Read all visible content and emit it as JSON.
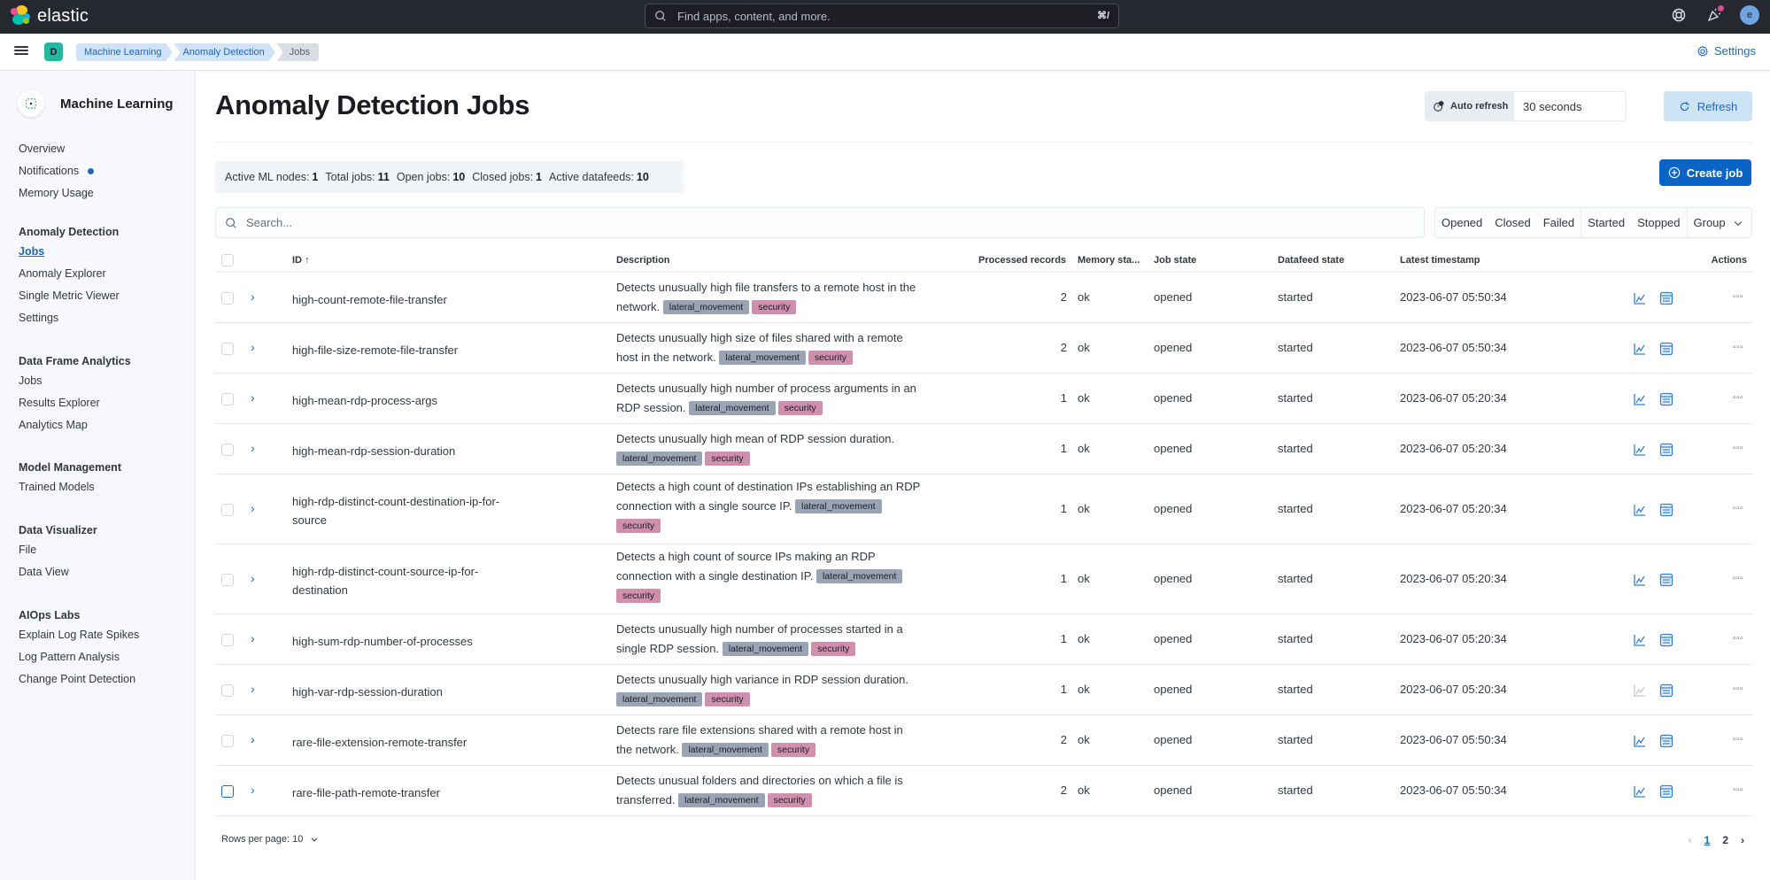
{
  "header": {
    "brand": "elastic",
    "search_placeholder": "Find apps, content, and more.",
    "search_shortcut": "⌘/",
    "avatar_initial": "e"
  },
  "subheader": {
    "space_initial": "D",
    "breadcrumbs": [
      "Machine Learning",
      "Anomaly Detection",
      "Jobs"
    ],
    "settings_label": "Settings"
  },
  "sidebar": {
    "title": "Machine Learning",
    "top_items": [
      {
        "label": "Overview"
      },
      {
        "label": "Notifications",
        "has_dot": true
      },
      {
        "label": "Memory Usage"
      }
    ],
    "groups": [
      {
        "heading": "Anomaly Detection",
        "items": [
          "Jobs",
          "Anomaly Explorer",
          "Single Metric Viewer",
          "Settings"
        ],
        "active": "Jobs"
      },
      {
        "heading": "Data Frame Analytics",
        "items": [
          "Jobs",
          "Results Explorer",
          "Analytics Map"
        ]
      },
      {
        "heading": "Model Management",
        "items": [
          "Trained Models"
        ]
      },
      {
        "heading": "Data Visualizer",
        "items": [
          "File",
          "Data View"
        ]
      },
      {
        "heading": "AIOps Labs",
        "items": [
          "Explain Log Rate Spikes",
          "Log Pattern Analysis",
          "Change Point Detection"
        ]
      }
    ]
  },
  "page": {
    "title": "Anomaly Detection Jobs",
    "auto_refresh_label": "Auto refresh",
    "auto_refresh_value": "30 seconds",
    "refresh_label": "Refresh",
    "create_job_label": "Create job",
    "stats": [
      {
        "label": "Active ML nodes:",
        "value": "1"
      },
      {
        "label": "Total jobs:",
        "value": "11"
      },
      {
        "label": "Open jobs:",
        "value": "10"
      },
      {
        "label": "Closed jobs:",
        "value": "1"
      },
      {
        "label": "Active datafeeds:",
        "value": "10"
      }
    ],
    "search_placeholder": "Search...",
    "filters": {
      "job_state": [
        "Opened",
        "Closed",
        "Failed"
      ],
      "datafeed_state": [
        "Started",
        "Stopped"
      ],
      "group": "Group"
    }
  },
  "table": {
    "columns": [
      "ID",
      "Description",
      "Processed records",
      "Memory sta...",
      "Job state",
      "Datafeed state",
      "Latest timestamp",
      "Actions"
    ],
    "sort": {
      "column": "ID",
      "direction": "asc"
    },
    "rows": [
      {
        "id": "high-count-remote-file-transfer",
        "description": "Detects unusually high file transfers to a remote host in the network.",
        "tags": [
          "lateral_movement",
          "security"
        ],
        "processed": "2",
        "memory": "ok",
        "job_state": "opened",
        "datafeed_state": "started",
        "timestamp": "2023-06-07 05:50:34",
        "smv_enabled": true
      },
      {
        "id": "high-file-size-remote-file-transfer",
        "description": "Detects unusually high size of files shared with a remote host in the network.",
        "tags": [
          "lateral_movement",
          "security"
        ],
        "processed": "2",
        "memory": "ok",
        "job_state": "opened",
        "datafeed_state": "started",
        "timestamp": "2023-06-07 05:50:34",
        "smv_enabled": true
      },
      {
        "id": "high-mean-rdp-process-args",
        "description": "Detects unusually high number of process arguments in an RDP session.",
        "tags": [
          "lateral_movement",
          "security"
        ],
        "processed": "1",
        "memory": "ok",
        "job_state": "opened",
        "datafeed_state": "started",
        "timestamp": "2023-06-07 05:20:34",
        "smv_enabled": true
      },
      {
        "id": "high-mean-rdp-session-duration",
        "description": "Detects unusually high mean of RDP session duration.",
        "tags": [
          "lateral_movement",
          "security"
        ],
        "processed": "1",
        "memory": "ok",
        "job_state": "opened",
        "datafeed_state": "started",
        "timestamp": "2023-06-07 05:20:34",
        "smv_enabled": true
      },
      {
        "id": "high-rdp-distinct-count-destination-ip-for-source",
        "description": "Detects a high count of destination IPs establishing an RDP connection with a single source IP.",
        "tags": [
          "lateral_movement",
          "security"
        ],
        "processed": "1",
        "memory": "ok",
        "job_state": "opened",
        "datafeed_state": "started",
        "timestamp": "2023-06-07 05:20:34",
        "smv_enabled": true
      },
      {
        "id": "high-rdp-distinct-count-source-ip-for-destination",
        "description": "Detects a high count of source IPs making an RDP connection with a single destination IP.",
        "tags": [
          "lateral_movement",
          "security"
        ],
        "processed": "1",
        "memory": "ok",
        "job_state": "opened",
        "datafeed_state": "started",
        "timestamp": "2023-06-07 05:20:34",
        "smv_enabled": true
      },
      {
        "id": "high-sum-rdp-number-of-processes",
        "description": "Detects unusually high number of processes started in a single RDP session.",
        "tags": [
          "lateral_movement",
          "security"
        ],
        "processed": "1",
        "memory": "ok",
        "job_state": "opened",
        "datafeed_state": "started",
        "timestamp": "2023-06-07 05:20:34",
        "smv_enabled": true
      },
      {
        "id": "high-var-rdp-session-duration",
        "description": "Detects unusually high variance in RDP session duration.",
        "tags": [
          "lateral_movement",
          "security"
        ],
        "processed": "1",
        "memory": "ok",
        "job_state": "opened",
        "datafeed_state": "started",
        "timestamp": "2023-06-07 05:20:34",
        "smv_enabled": false
      },
      {
        "id": "rare-file-extension-remote-transfer",
        "description": "Detects rare file extensions shared with a remote host in the network.",
        "tags": [
          "lateral_movement",
          "security"
        ],
        "processed": "2",
        "memory": "ok",
        "job_state": "opened",
        "datafeed_state": "started",
        "timestamp": "2023-06-07 05:50:34",
        "smv_enabled": true
      },
      {
        "id": "rare-file-path-remote-transfer",
        "description": "Detects unusual folders and directories on which a file is transferred.",
        "tags": [
          "lateral_movement",
          "security"
        ],
        "processed": "2",
        "memory": "ok",
        "job_state": "opened",
        "datafeed_state": "started",
        "timestamp": "2023-06-07 05:50:34",
        "smv_enabled": true
      }
    ]
  },
  "pagination": {
    "rows_per_page_label": "Rows per page: 10",
    "pages": [
      "1",
      "2"
    ],
    "current": "1"
  },
  "colors": {
    "primary": "#0b64c4",
    "link": "#1f68b8",
    "tag_lateral_movement": "#9aa4b5",
    "tag_security": "#d18fae",
    "header_bg": "#25282f"
  }
}
